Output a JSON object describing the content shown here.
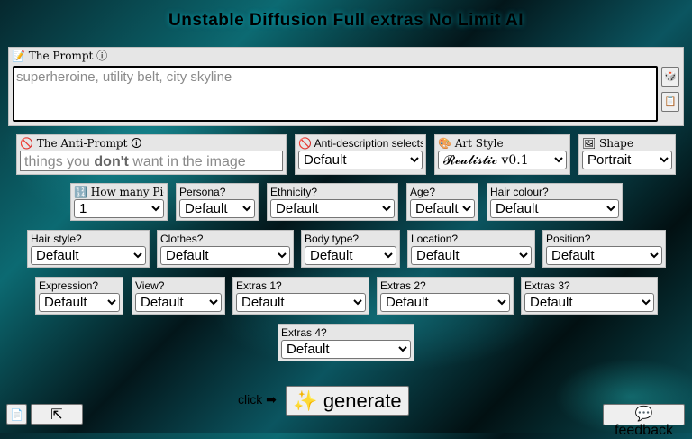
{
  "title": "Unstable Diffusion Full extras No Limit AI",
  "prompt": {
    "label": "📝 The Prompt ⓘ",
    "placeholder": "superheroine, utility belt, city skyline",
    "side_buttons": [
      "🎲",
      "📋"
    ]
  },
  "anti_prompt": {
    "label": "🚫 The Anti-Prompt 🛈",
    "placeholder_before": "things you ",
    "placeholder_bold": "don't",
    "placeholder_after": " want in the image"
  },
  "selects": {
    "anti_desc": {
      "label": "🚫 Anti-description selects",
      "value": "Default"
    },
    "art_style": {
      "label": "🎨 Art Style",
      "value": "𝓡𝓮𝓪𝓵𝓲𝓼𝓽𝓲𝓬 v0.1"
    },
    "shape": {
      "label": "🖼 Shape",
      "value": "Portrait"
    },
    "how_many": {
      "label": "🔢 How many Pics?",
      "value": "1"
    },
    "persona": {
      "label": "Persona?",
      "value": "Default"
    },
    "ethnicity": {
      "label": "Ethnicity?",
      "value": "Default"
    },
    "age": {
      "label": "Age?",
      "value": "Default"
    },
    "hair_colour": {
      "label": "Hair colour?",
      "value": "Default"
    },
    "hair_style": {
      "label": "Hair style?",
      "value": "Default"
    },
    "clothes": {
      "label": "Clothes?",
      "value": "Default"
    },
    "body_type": {
      "label": "Body type?",
      "value": "Default"
    },
    "location": {
      "label": "Location?",
      "value": "Default"
    },
    "position": {
      "label": "Position?",
      "value": "Default"
    },
    "expression": {
      "label": "Expression?",
      "value": "Default"
    },
    "view": {
      "label": "View?",
      "value": "Default"
    },
    "extras1": {
      "label": "Extras 1?",
      "value": "Default"
    },
    "extras2": {
      "label": "Extras 2?",
      "value": "Default"
    },
    "extras3": {
      "label": "Extras 3?",
      "value": "Default"
    },
    "extras4": {
      "label": "Extras 4?",
      "value": "Default"
    }
  },
  "footer": {
    "click_hint": "click ➡",
    "generate_label": "✨ generate",
    "feedback_label": "💬 feedback",
    "left_icon": "📄",
    "expand_icon": "⇱"
  }
}
